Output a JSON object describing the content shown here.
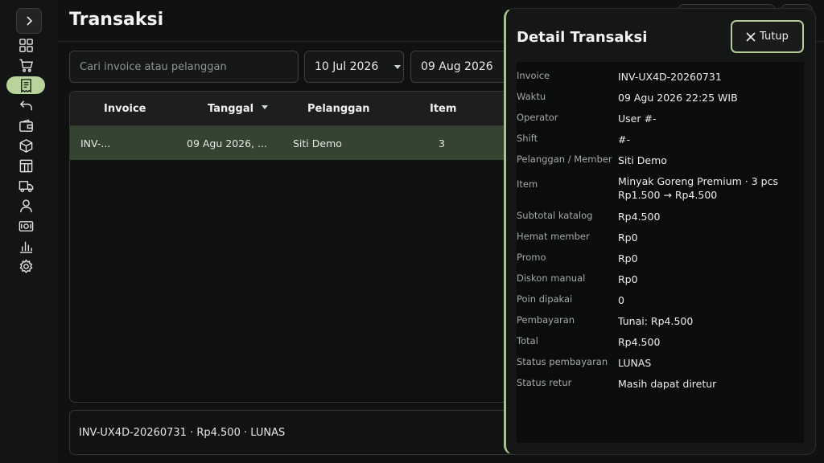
{
  "page": {
    "title": "Transaksi"
  },
  "sidebar": {
    "toggle_icon": "chevron-right-icon",
    "items": [
      {
        "name": "dashboard",
        "icon": "grid-icon",
        "active": false
      },
      {
        "name": "kasir",
        "icon": "cart-icon",
        "active": false
      },
      {
        "name": "transaksi",
        "icon": "receipt-icon",
        "active": true
      },
      {
        "name": "retur",
        "icon": "undo-icon",
        "active": false
      },
      {
        "name": "wallet",
        "icon": "wallet-icon",
        "active": false
      },
      {
        "name": "produk",
        "icon": "box-icon",
        "active": false
      },
      {
        "name": "tabel",
        "icon": "table-icon",
        "active": false
      },
      {
        "name": "pengiriman",
        "icon": "truck-icon",
        "active": false
      },
      {
        "name": "pelanggan",
        "icon": "user-icon",
        "active": false
      },
      {
        "name": "keuangan",
        "icon": "money-icon",
        "active": false
      },
      {
        "name": "laporan",
        "icon": "chart-icon",
        "active": false
      },
      {
        "name": "pengaturan",
        "icon": "gear-icon",
        "active": false
      }
    ]
  },
  "filters": {
    "search_placeholder": "Cari invoice atau pelanggan",
    "search_value": "",
    "date_from": "10 Jul 2026",
    "date_to": "09 Aug 2026"
  },
  "table": {
    "headers": {
      "invoice": "Invoice",
      "tanggal": "Tanggal",
      "pelanggan": "Pelanggan",
      "item": "Item"
    },
    "rows": [
      {
        "invoice": "INV-...",
        "tanggal": "09 Agu 2026, ...",
        "pelanggan": "Siti Demo",
        "item": "3"
      }
    ]
  },
  "summary": "INV-UX4D-20260731 · Rp4.500 · LUNAS",
  "detail": {
    "title": "Detail Transaksi",
    "close_label": "Tutup",
    "rows": [
      {
        "label": "Invoice",
        "value": "INV-UX4D-20260731"
      },
      {
        "label": "Waktu",
        "value": "09 Agu 2026 22:25 WIB"
      },
      {
        "label": "Operator",
        "value": "User #-"
      },
      {
        "label": "Shift",
        "value": "#-"
      },
      {
        "label": "Pelanggan / Member",
        "value": "Siti Demo"
      },
      {
        "label": "Item",
        "value": "Minyak Goreng Premium · 3 pcs",
        "value2": "Rp1.500 → Rp4.500"
      },
      {
        "label": "Subtotal katalog",
        "value": "Rp4.500"
      },
      {
        "label": "Hemat member",
        "value": "Rp0"
      },
      {
        "label": "Promo",
        "value": "Rp0"
      },
      {
        "label": "Diskon manual",
        "value": "Rp0"
      },
      {
        "label": "Poin dipakai",
        "value": "0"
      },
      {
        "label": "Pembayaran",
        "value": "Tunai: Rp4.500"
      },
      {
        "label": "Total",
        "value": "Rp4.500"
      },
      {
        "label": "Status pembayaran",
        "value": "LUNAS"
      },
      {
        "label": "Status retur",
        "value": "Masih dapat diretur"
      }
    ]
  },
  "colors": {
    "accent": "#b8d39c",
    "selected_row": "#354331",
    "background": "#101111"
  }
}
